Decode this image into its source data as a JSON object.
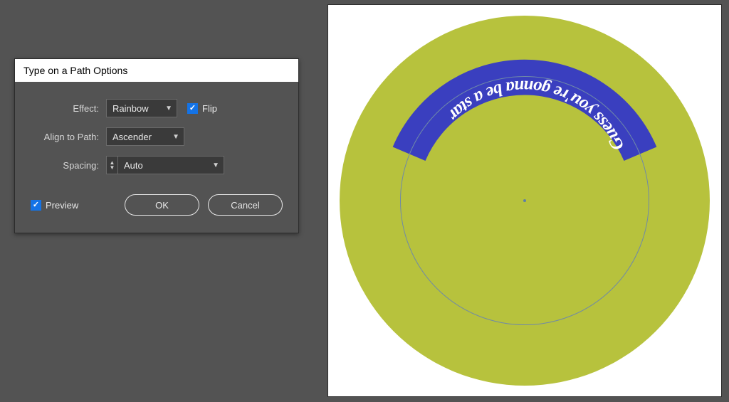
{
  "dialog": {
    "title": "Type on a Path Options",
    "labels": {
      "effect": "Effect:",
      "align": "Align to Path:",
      "spacing": "Spacing:",
      "flip": "Flip",
      "preview": "Preview"
    },
    "values": {
      "effect": "Rainbow",
      "align": "Ascender",
      "spacing": "Auto"
    },
    "flip_checked": true,
    "preview_checked": true,
    "buttons": {
      "ok": "OK",
      "cancel": "Cancel"
    }
  },
  "artwork": {
    "path_text": "Guess you're gonna be a star",
    "circle_fill": "#b7c23d",
    "band_color": "#3a3fbf",
    "text_color": "#ffffff"
  }
}
